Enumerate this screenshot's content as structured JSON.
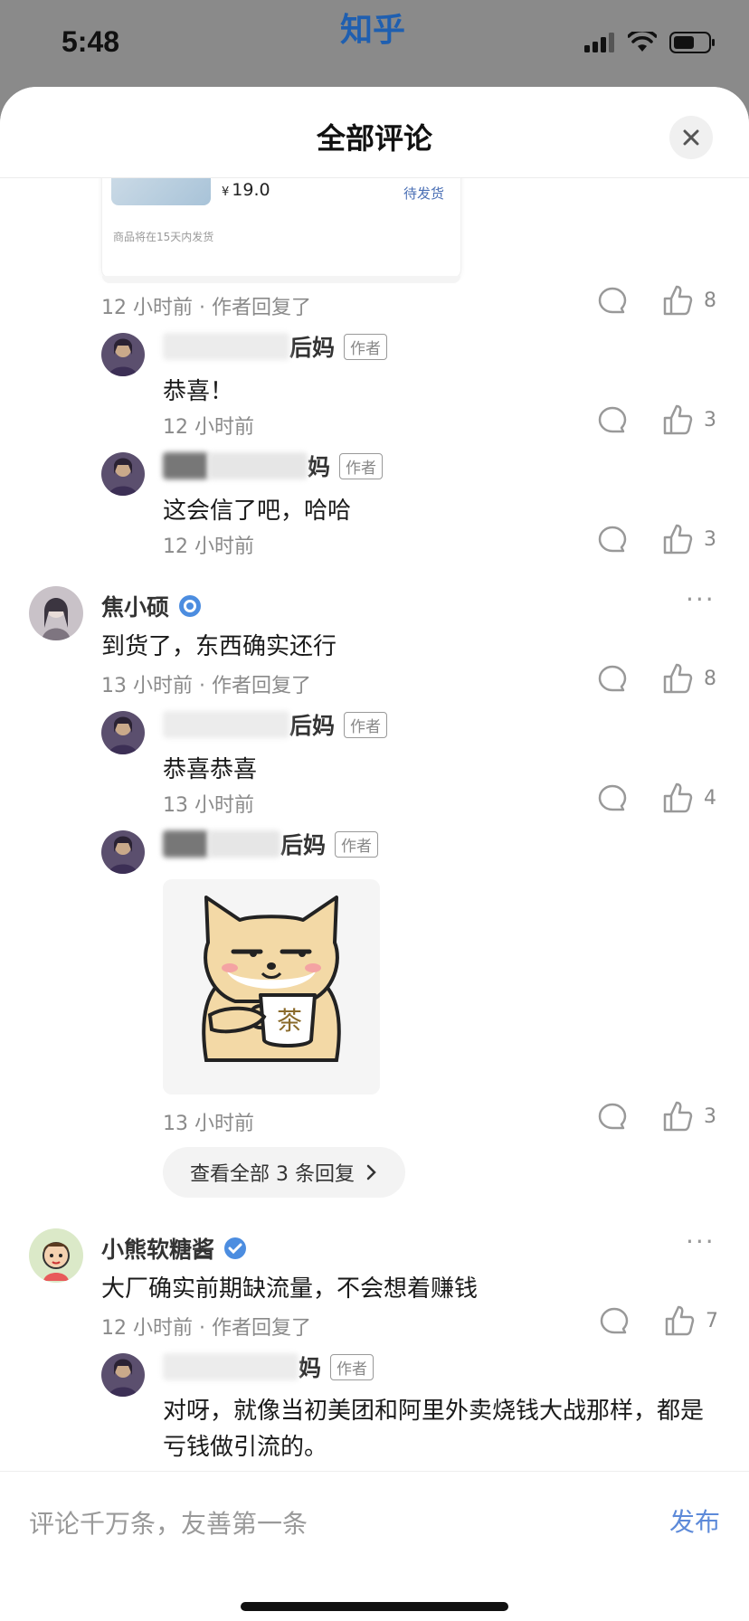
{
  "status_bar": {
    "time": "5:48",
    "app_brand": "知乎",
    "icons": [
      "signal-icon",
      "wifi-icon",
      "battery-icon"
    ]
  },
  "sheet": {
    "title": "全部评论",
    "close_icon": "close-icon"
  },
  "order_card": {
    "currency": "¥",
    "price": "19.0",
    "status": "待发货",
    "note": "商品将在15天内发货"
  },
  "comments": [
    {
      "meta": "12 小时前 · 作者回复了",
      "likes": "8",
      "replies": [
        {
          "name_visible": "后妈",
          "badge": "作者",
          "text": "恭喜！",
          "time": "12 小时前",
          "likes": "3"
        },
        {
          "name_visible": "妈",
          "badge": "作者",
          "text": "这会信了吧，哈哈",
          "time": "12 小时前",
          "likes": "3"
        }
      ]
    },
    {
      "author": "焦小硕",
      "text": "到货了，东西确实还行",
      "meta": "13 小时前 · 作者回复了",
      "likes": "8",
      "replies": [
        {
          "name_visible": "后妈",
          "badge": "作者",
          "text": "恭喜恭喜",
          "time": "13 小时前",
          "likes": "4"
        },
        {
          "name_visible": "后妈",
          "badge": "作者",
          "sticker": "茶",
          "time": "13 小时前",
          "likes": "3"
        }
      ],
      "view_all": "查看全部 3 条回复"
    },
    {
      "author": "小熊软糖酱",
      "text": "大厂确实前期缺流量，不会想着赚钱",
      "meta": "12 小时前 · 作者回复了",
      "likes": "7",
      "replies": [
        {
          "name_visible": "妈",
          "badge": "作者",
          "text": "对呀，就像当初美团和阿里外卖烧钱大战那样，都是亏钱做引流的。"
        }
      ]
    }
  ],
  "composer": {
    "placeholder": "评论千万条，友善第一条",
    "publish": "发布"
  }
}
